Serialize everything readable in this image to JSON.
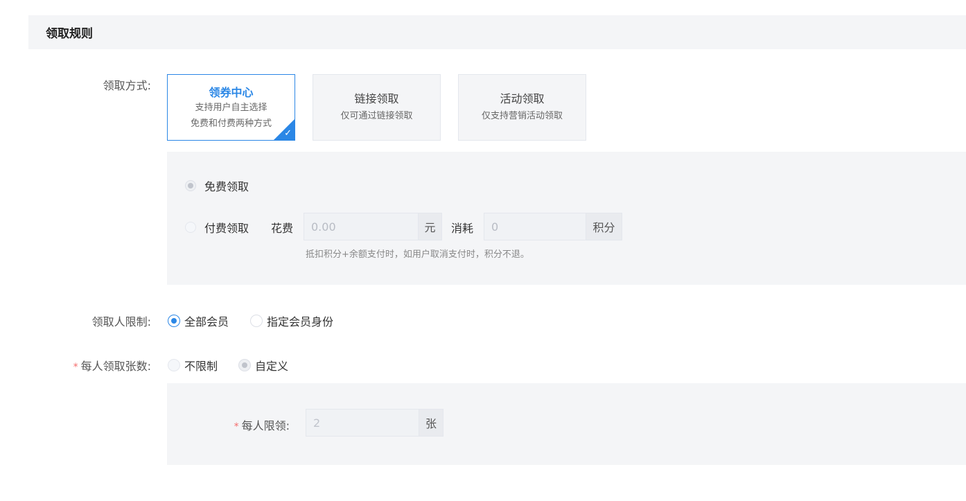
{
  "section": {
    "title": "领取规则"
  },
  "receive_method": {
    "label": "领取方式:",
    "cards": [
      {
        "title": "领券中心",
        "desc1": "支持用户自主选择",
        "desc2": "免费和付费两种方式"
      },
      {
        "title": "链接领取",
        "desc1": "仅可通过链接领取"
      },
      {
        "title": "活动领取",
        "desc1": "仅支持营销活动领取"
      }
    ],
    "free_label": "免费领取",
    "paid_label": "付费领取",
    "cost_label": "花费",
    "cost_placeholder": "0.00",
    "cost_unit": "元",
    "consume_label": "消耗",
    "points_placeholder": "0",
    "points_unit": "积分",
    "hint": "抵扣积分+余额支付时，如用户取消支付时，积分不退。"
  },
  "receiver_limit": {
    "label": "领取人限制:",
    "options": [
      "全部会员",
      "指定会员身份"
    ]
  },
  "per_person": {
    "required_mark": "*",
    "label": "每人领取张数:",
    "options": [
      "不限制",
      "自定义"
    ],
    "limit_label": "每人限领:",
    "limit_value": "2",
    "limit_unit": "张"
  },
  "colors": {
    "accent": "#2b87e6",
    "required": "#f56c6c",
    "panel": "#f4f5f7"
  }
}
